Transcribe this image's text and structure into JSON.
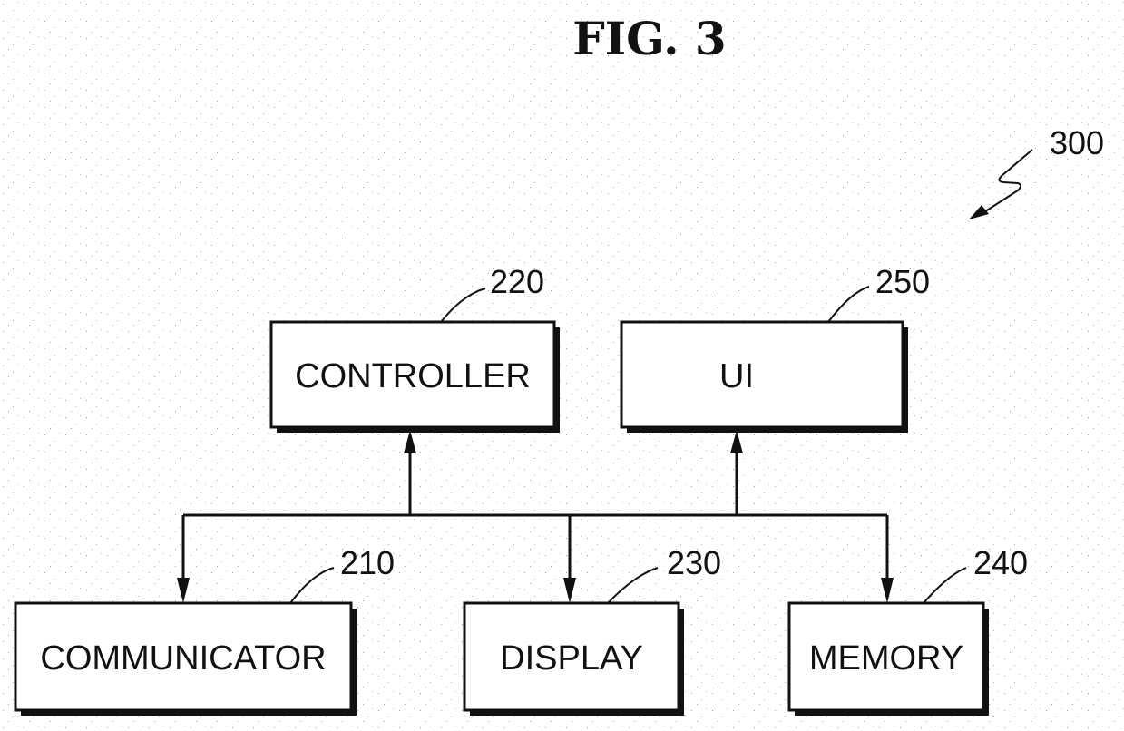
{
  "figure": {
    "title": "FIG.  3",
    "reference": "300"
  },
  "blocks": [
    {
      "id": "controller",
      "label": "CONTROLLER",
      "ref": "220"
    },
    {
      "id": "ui",
      "label": "UI",
      "ref": "250"
    },
    {
      "id": "communicator",
      "label": "COMMUNICATOR",
      "ref": "210"
    },
    {
      "id": "display",
      "label": "DISPLAY",
      "ref": "230"
    },
    {
      "id": "memory",
      "label": "MEMORY",
      "ref": "240"
    }
  ],
  "connections": [
    {
      "from": "bus",
      "to": "controller",
      "direction": "up"
    },
    {
      "from": "bus",
      "to": "ui",
      "direction": "up"
    },
    {
      "from": "bus",
      "to": "communicator",
      "direction": "down"
    },
    {
      "from": "bus",
      "to": "display",
      "direction": "down"
    },
    {
      "from": "bus",
      "to": "memory",
      "direction": "down"
    }
  ]
}
